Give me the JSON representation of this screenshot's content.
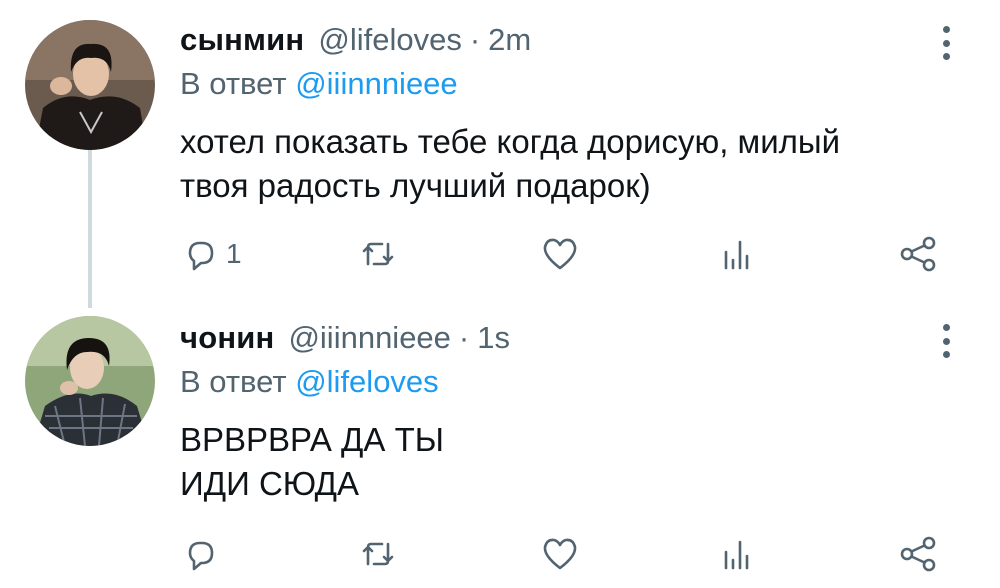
{
  "tweets": [
    {
      "author": "сынмин",
      "handle": "@lifeloves",
      "separator": "·",
      "time": "2m",
      "reply_prefix": "В ответ",
      "reply_to": "@iiinnnieee",
      "text_lines": [
        "хотел показать тебе когда дорисую, милый",
        "твоя радость лучший подарок)"
      ],
      "reply_count": "1",
      "icons": [
        "reply-icon",
        "retweet-icon",
        "heart-icon",
        "views-icon",
        "share-icon",
        "more-icon"
      ]
    },
    {
      "author": "чонин",
      "handle": "@iiinnnieee",
      "separator": "·",
      "time": "1s",
      "reply_prefix": "В ответ",
      "reply_to": "@lifeloves",
      "text_lines": [
        "ВРВРВРА ДА ТЫ",
        "ИДИ СЮДА"
      ],
      "reply_count": "",
      "icons": [
        "reply-icon",
        "retweet-icon",
        "heart-icon",
        "views-icon",
        "share-icon",
        "more-icon"
      ]
    }
  ],
  "colors": {
    "text": "#0f1419",
    "secondary": "#536471",
    "link": "#1d9bf0",
    "thread_line": "#cfd9de"
  }
}
